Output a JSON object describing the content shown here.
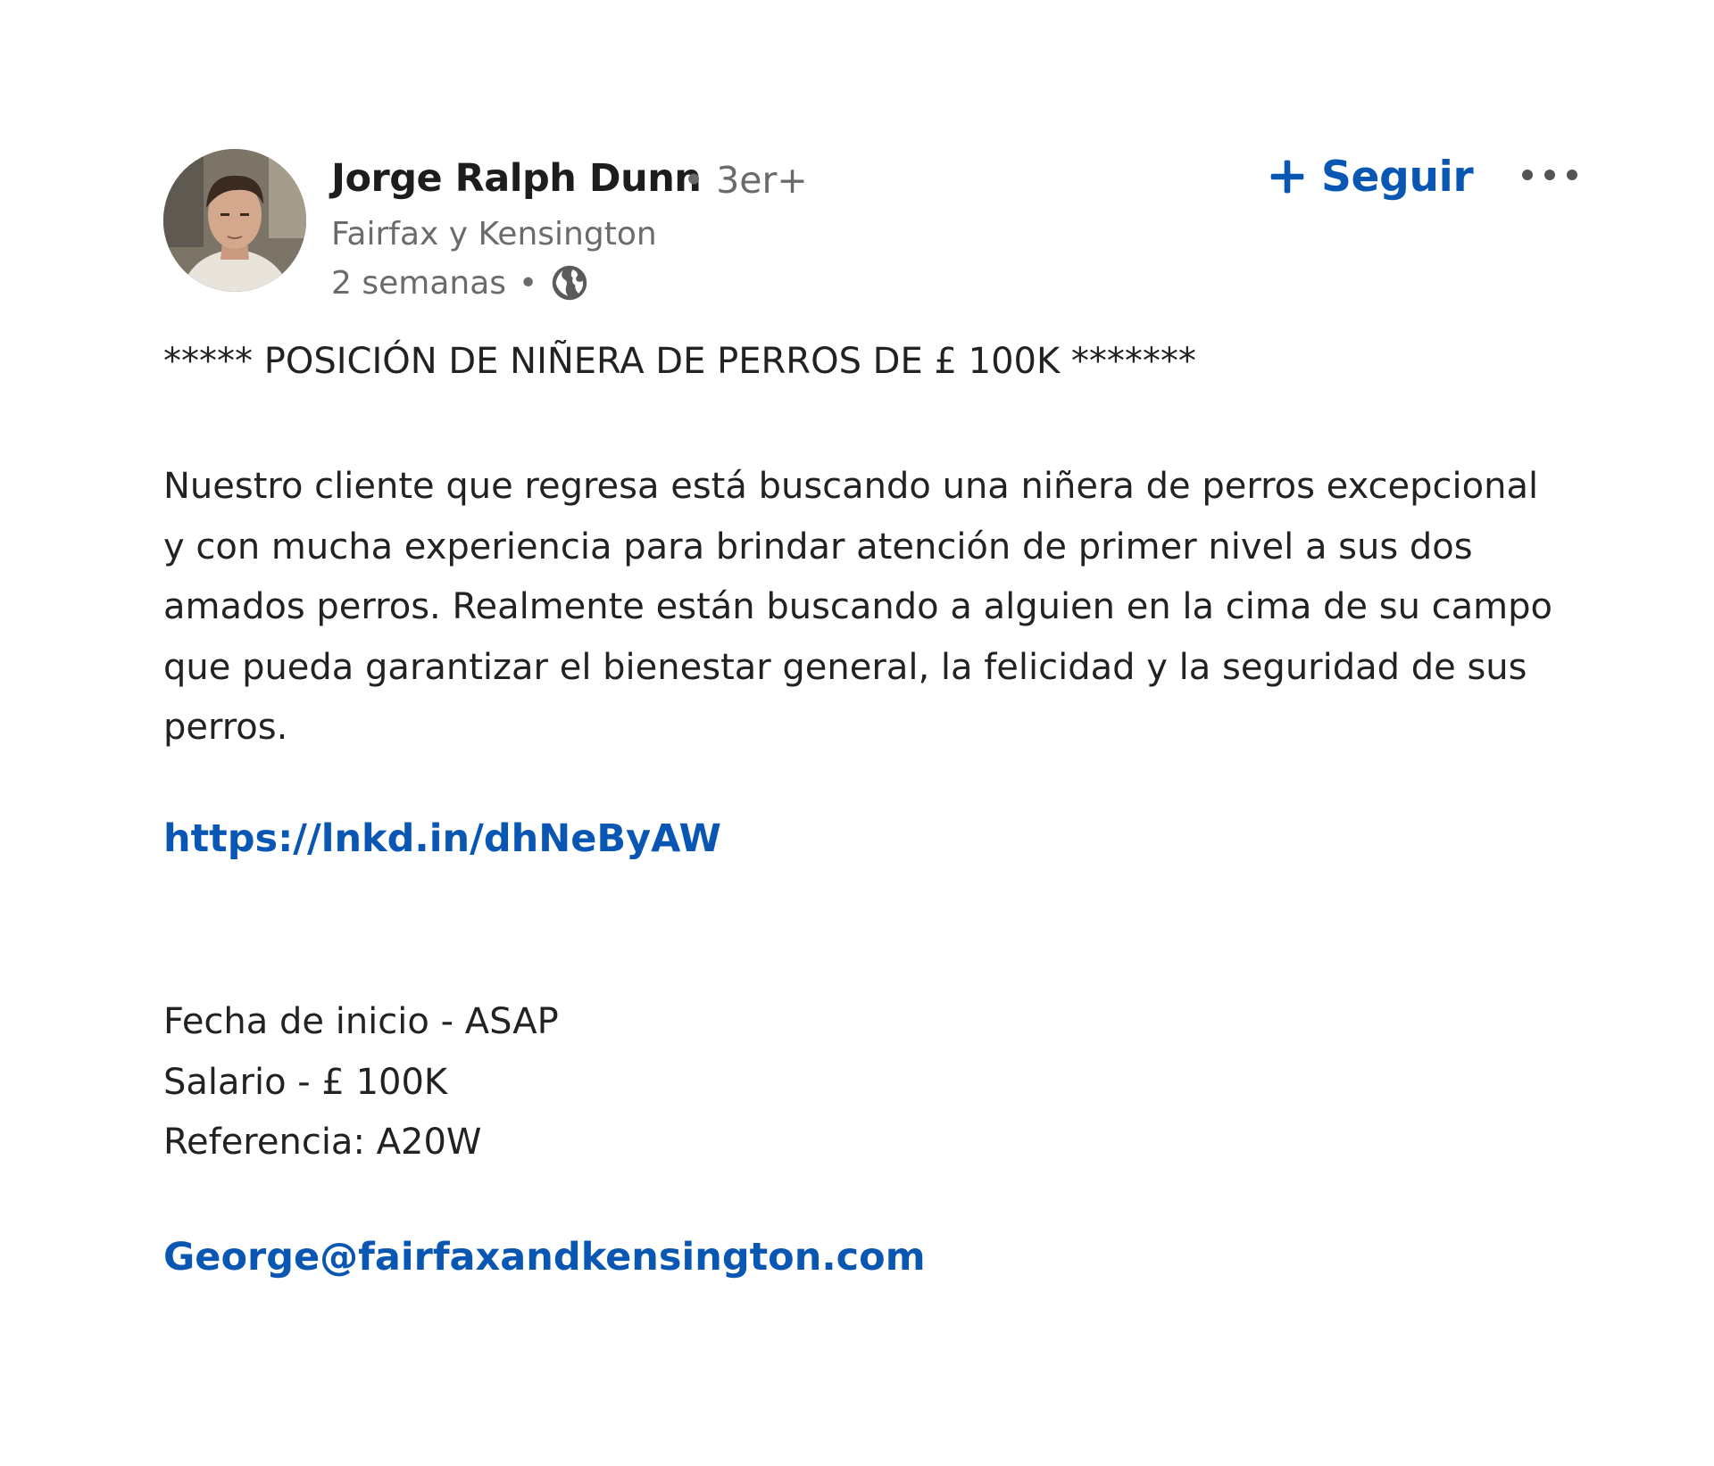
{
  "author": {
    "name": "Jorge Ralph Dunn",
    "degree": "• 3er+",
    "headline": "Fairfax y Kensington",
    "timestamp": "2 semanas",
    "separator": "•",
    "visibility_icon": "globe-icon"
  },
  "actions": {
    "follow_label": "Seguir",
    "follow_icon": "plus-icon",
    "more_icon": "more-options-icon",
    "accent_color": "#0a56b3"
  },
  "post": {
    "title": "***** POSICIÓN DE NIÑERA DE PERROS DE £ 100K *******",
    "body": "Nuestro cliente que regresa está buscando una niñera de perros excepcional y con mucha experiencia para brindar atención de primer nivel a sus dos amados perros. Realmente están buscando a alguien en la cima de su campo que pueda garantizar el bienestar general, la felicidad y la seguridad de sus perros.",
    "link": "https://lnkd.in/dhNeByAW",
    "details": [
      "Fecha de inicio - ASAP",
      "Salario - £ 100K",
      "Referencia: A20W"
    ],
    "email": "George@fairfaxandkensington.com"
  }
}
